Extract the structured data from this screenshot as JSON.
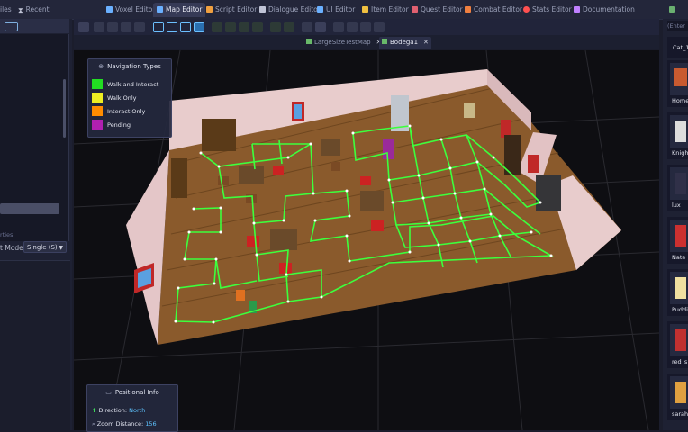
{
  "top_tabs": [
    {
      "label": "iles",
      "icon": "file-icon",
      "color": "#8a8fa8",
      "active": false
    },
    {
      "label": "Recent",
      "icon": "hourglass-icon",
      "color": "#c0c4d6",
      "active": false
    },
    {
      "label": "Voxel Editor",
      "icon": "cube-icon",
      "color": "#6ab0ff",
      "active": false
    },
    {
      "label": "Map Editor",
      "icon": "map-icon",
      "color": "#6ab0ff",
      "active": true
    },
    {
      "label": "Script Editor",
      "icon": "script-icon",
      "color": "#f0a040",
      "active": false
    },
    {
      "label": "Dialogue Editor",
      "icon": "speech-icon",
      "color": "#c0c4d6",
      "active": false
    },
    {
      "label": "UI Editor",
      "icon": "ui-icon",
      "color": "#6ab0ff",
      "active": false
    },
    {
      "label": "Item Editor",
      "icon": "key-icon",
      "color": "#f0c040",
      "active": false
    },
    {
      "label": "Quest Editor",
      "icon": "quest-icon",
      "color": "#e06070",
      "active": false
    },
    {
      "label": "Combat Editor",
      "icon": "sword-icon",
      "color": "#f08040",
      "active": false
    },
    {
      "label": "Stats Editor",
      "icon": "heart-icon",
      "color": "#ff5050",
      "active": false
    },
    {
      "label": "Documentation",
      "icon": "book-icon",
      "color": "#c080ff",
      "active": false
    }
  ],
  "left_panel": {
    "properties_label": "rties",
    "mode_label": "t Mode:",
    "mode_value": "Single (S)"
  },
  "file_tabs": [
    {
      "label": "LargeSizeTestMap",
      "active": false
    },
    {
      "label": "Bodega1",
      "active": true
    }
  ],
  "close_glyph": "✕",
  "legend": {
    "title": "Navigation Types",
    "items": [
      {
        "label": "Walk and Interact",
        "color": "#22dd22"
      },
      {
        "label": "Walk Only",
        "color": "#eeee22"
      },
      {
        "label": "Interact Only",
        "color": "#ff8c00"
      },
      {
        "label": "Pending",
        "color": "#b020b0"
      }
    ]
  },
  "positional_info": {
    "title": "Positional Info",
    "direction_label": "Direction:",
    "direction_value": "North",
    "zoom_label": "Zoom Distance:",
    "zoom_value": "156"
  },
  "right_panel": {
    "search_placeholder": "(Enter",
    "items": [
      {
        "label": "Cat_1",
        "color": "#2a2e44"
      },
      {
        "label": "Home",
        "color": "#c85a30"
      },
      {
        "label": "Knigh",
        "color": "#dddddd"
      },
      {
        "label": "lux",
        "color": "#303048"
      },
      {
        "label": "Nate",
        "color": "#cc3030"
      },
      {
        "label": "Puddi",
        "color": "#f0e0a0"
      },
      {
        "label": "red_s",
        "color": "#c03030"
      },
      {
        "label": "sarah",
        "color": "#e0a040"
      }
    ]
  },
  "colors": {
    "nav_grid": "#3dff3d",
    "floor": "#8a5a2c",
    "wall": "#e8cccc"
  }
}
